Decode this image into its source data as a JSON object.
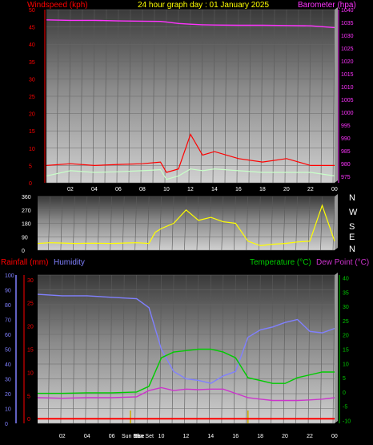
{
  "header": {
    "windspeed_label": "Windspeed (kph)",
    "title": "24 hour graph day : 01 January 2025",
    "barometer_label": "Barometer (hpa)"
  },
  "lower_header": {
    "rainfall_label": "Rainfall (mm)",
    "humidity_label": "Humidity",
    "temperature_label": "Temperature (°C)",
    "dewpoint_label": "Dew Point (°C)"
  },
  "compass_letters": [
    "N",
    "W",
    "S",
    "E",
    "N"
  ],
  "sun_labels": [
    "Sun Rise",
    "Sun Set"
  ],
  "colors": {
    "wind": "#ff0000",
    "wind_avg": "#c8ffc8",
    "barometer": "#ff33ff",
    "direction": "#ffff00",
    "rain": "#ff0000",
    "humidity": "#8080ff",
    "temperature": "#00cc00",
    "dewpoint": "#cc33cc",
    "sun_marker": "#ccaa00"
  },
  "chart_data": [
    {
      "type": "line",
      "name": "wind_and_barometer",
      "x_ticks": [
        "02",
        "04",
        "06",
        "08",
        "10",
        "12",
        "14",
        "16",
        "18",
        "20",
        "22",
        "00"
      ],
      "left_axis": {
        "label": "Windspeed (kph)",
        "ticks": [
          0,
          5,
          10,
          15,
          20,
          25,
          30,
          35,
          40,
          45,
          50
        ],
        "ylim": [
          0,
          50
        ]
      },
      "right_axis": {
        "label": "Barometer (hpa)",
        "ticks": [
          975,
          980,
          985,
          990,
          995,
          1000,
          1005,
          1010,
          1015,
          1020,
          1025,
          1030,
          1035,
          1040
        ],
        "ylim": [
          972.5,
          1040
        ]
      },
      "x": [
        0,
        2,
        4,
        6,
        8,
        9.5,
        10,
        11,
        12,
        13,
        14,
        16,
        18,
        20,
        22,
        24
      ],
      "series": [
        {
          "key": "barometer",
          "axis": "right",
          "values": [
            1036,
            1035.8,
            1035.8,
            1035.6,
            1035.5,
            1035.4,
            1035.2,
            1034.6,
            1034.3,
            1034.1,
            1034,
            1033.9,
            1033.9,
            1033.8,
            1033.7,
            1033
          ]
        },
        {
          "key": "wind_gust",
          "axis": "left",
          "values": [
            5,
            5.5,
            5,
            5.3,
            5.5,
            6,
            3,
            4,
            14,
            8,
            9,
            7,
            6,
            7,
            5,
            5
          ]
        },
        {
          "key": "wind_avg",
          "axis": "left",
          "values": [
            2,
            3.5,
            3,
            3.2,
            3.5,
            3.8,
            1,
            2,
            4,
            3.5,
            4,
            3.5,
            3,
            3,
            3,
            2
          ]
        }
      ]
    },
    {
      "type": "line",
      "name": "wind_direction",
      "left_axis": {
        "ticks": [
          0,
          90,
          180,
          270,
          360
        ],
        "ylim": [
          0,
          360
        ]
      },
      "x": [
        0,
        1,
        2,
        3,
        4,
        5,
        6,
        7,
        8,
        9,
        9.5,
        10,
        11,
        12,
        13,
        14,
        15,
        16,
        17,
        18,
        19,
        20,
        21,
        22,
        23,
        24
      ],
      "series": [
        {
          "key": "direction",
          "values": [
            45,
            50,
            48,
            45,
            47,
            46,
            45,
            48,
            50,
            45,
            120,
            145,
            180,
            270,
            200,
            220,
            190,
            180,
            60,
            30,
            40,
            45,
            55,
            60,
            300,
            60
          ]
        }
      ]
    },
    {
      "type": "line",
      "name": "rain_humidity_temperature",
      "x_ticks": [
        "02",
        "04",
        "06",
        "08",
        "10",
        "12",
        "14",
        "16",
        "18",
        "20",
        "22",
        "00"
      ],
      "rain_axis": {
        "label": "Rainfall (mm)",
        "ticks": [
          0,
          5,
          10,
          15,
          20,
          25,
          30
        ],
        "ylim": [
          -1,
          31
        ]
      },
      "humidity_axis": {
        "label": "Humidity",
        "ticks": [
          0,
          10,
          20,
          30,
          40,
          50,
          60,
          70,
          80,
          90,
          100
        ],
        "ylim": [
          0,
          100
        ]
      },
      "temp_axis": {
        "label": "Temperature (°C)",
        "ticks": [
          -10,
          -5,
          0,
          5,
          10,
          15,
          20,
          25,
          30,
          35,
          40
        ],
        "ylim": [
          -11,
          41
        ]
      },
      "sun_rise_hour": 7.5,
      "sun_set_hour": 17,
      "x": [
        0,
        2,
        4,
        6,
        8,
        9,
        10,
        11,
        12,
        13,
        14,
        15,
        16,
        17,
        18,
        19,
        20,
        21,
        22,
        23,
        24
      ],
      "series": [
        {
          "key": "humidity",
          "axis": "humidity",
          "values": [
            87,
            86,
            86,
            85,
            84,
            78,
            50,
            35,
            30,
            29,
            27,
            32,
            35,
            58,
            63,
            65,
            68,
            70,
            62,
            61,
            64
          ]
        },
        {
          "key": "temperature",
          "axis": "temp",
          "values": [
            -0.5,
            -0.5,
            -0.3,
            -0.3,
            0,
            2,
            12,
            14,
            14.5,
            15,
            15,
            14,
            12,
            5,
            4,
            3,
            3,
            5,
            6,
            7,
            7
          ]
        },
        {
          "key": "dewpoint",
          "axis": "temp",
          "values": [
            -2,
            -2.2,
            -2,
            -2,
            -1.7,
            0.5,
            1.5,
            0.5,
            1,
            0.8,
            1,
            1,
            -0.5,
            -2,
            -2.5,
            -3,
            -3,
            -3,
            -2.8,
            -2.5,
            -2
          ]
        },
        {
          "key": "rain",
          "axis": "rain",
          "values": [
            0,
            0,
            0,
            0,
            0,
            0,
            0,
            0,
            0,
            0,
            0,
            0,
            0,
            0,
            0,
            0,
            0,
            0,
            0,
            0,
            0
          ]
        }
      ]
    }
  ]
}
